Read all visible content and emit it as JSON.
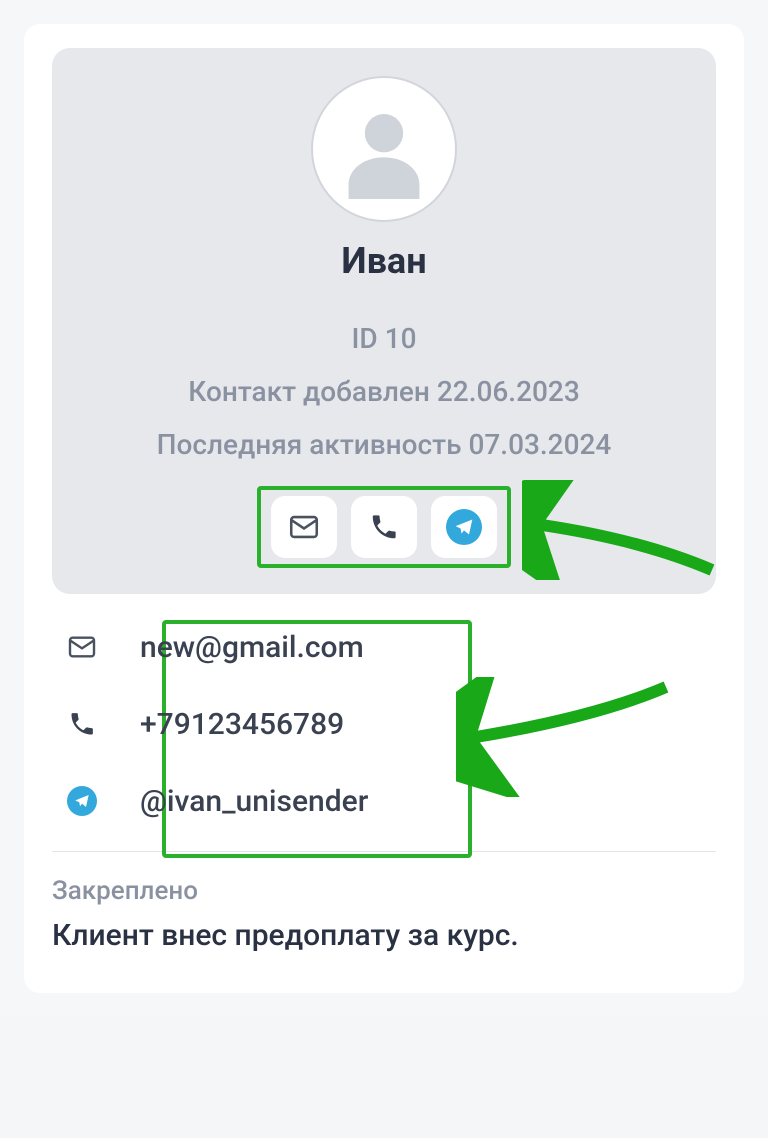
{
  "profile": {
    "name": "Иван",
    "id_label": "ID 10",
    "added": "Контакт добавлен 22.06.2023",
    "last_activity": "Последняя активность 07.03.2024"
  },
  "contacts": {
    "email": "new@gmail.com",
    "phone": "+79123456789",
    "telegram": "@ivan_unisender"
  },
  "pinned": {
    "label": "Закреплено",
    "text": "Клиент внес предоплату за курс."
  },
  "colors": {
    "highlight": "#2bb02b",
    "telegram": "#32a8dd"
  }
}
